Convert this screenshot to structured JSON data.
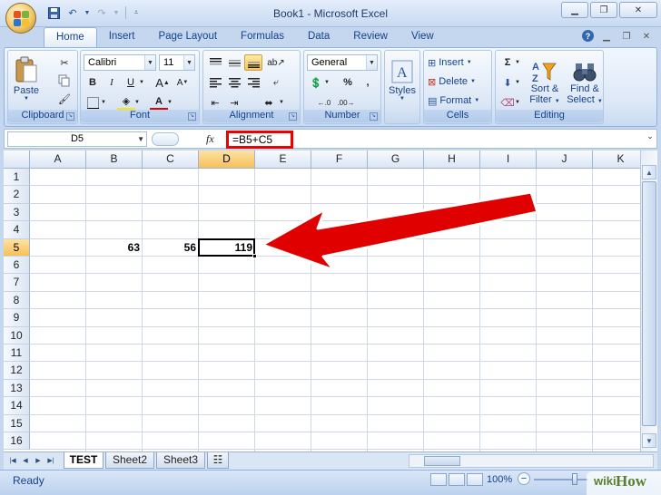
{
  "window": {
    "title": "Book1 - Microsoft Excel"
  },
  "ribbon": {
    "tabs": [
      "Home",
      "Insert",
      "Page Layout",
      "Formulas",
      "Data",
      "Review",
      "View"
    ],
    "active_tab": "Home",
    "clipboard": {
      "label": "Clipboard",
      "paste": "Paste"
    },
    "font": {
      "label": "Font",
      "name": "Calibri",
      "size": "11"
    },
    "alignment": {
      "label": "Alignment"
    },
    "number": {
      "label": "Number",
      "format": "General",
      "percent": "%",
      "comma": ","
    },
    "styles": {
      "label": "Styles"
    },
    "cells": {
      "label": "Cells",
      "insert": "Insert",
      "delete": "Delete",
      "format": "Format"
    },
    "editing": {
      "label": "Editing",
      "sort_filter": [
        "Sort &",
        "Filter"
      ],
      "find_select": [
        "Find &",
        "Select"
      ]
    }
  },
  "formula_bar": {
    "name_box": "D5",
    "fx": "fx",
    "formula": "=B5+C5"
  },
  "grid": {
    "columns": [
      "A",
      "B",
      "C",
      "D",
      "E",
      "F",
      "G",
      "H",
      "I",
      "J",
      "K"
    ],
    "rows": [
      "1",
      "2",
      "3",
      "4",
      "5",
      "6",
      "7",
      "8",
      "9",
      "10",
      "11",
      "12",
      "13",
      "14",
      "15",
      "16"
    ],
    "selected_column": "D",
    "selected_row": "5",
    "cells": [
      {
        "ref": "B5",
        "value": "63"
      },
      {
        "ref": "C5",
        "value": "56"
      },
      {
        "ref": "D5",
        "value": "119"
      }
    ]
  },
  "sheets": {
    "tabs": [
      "TEST",
      "Sheet2",
      "Sheet3"
    ],
    "active": "TEST"
  },
  "status": {
    "text": "Ready",
    "zoom": "100%"
  },
  "watermark": {
    "prefix": "wiki",
    "suffix": "How"
  },
  "colors": {
    "annotation_red": "#e00000",
    "selection_orange": "#f6c158"
  }
}
